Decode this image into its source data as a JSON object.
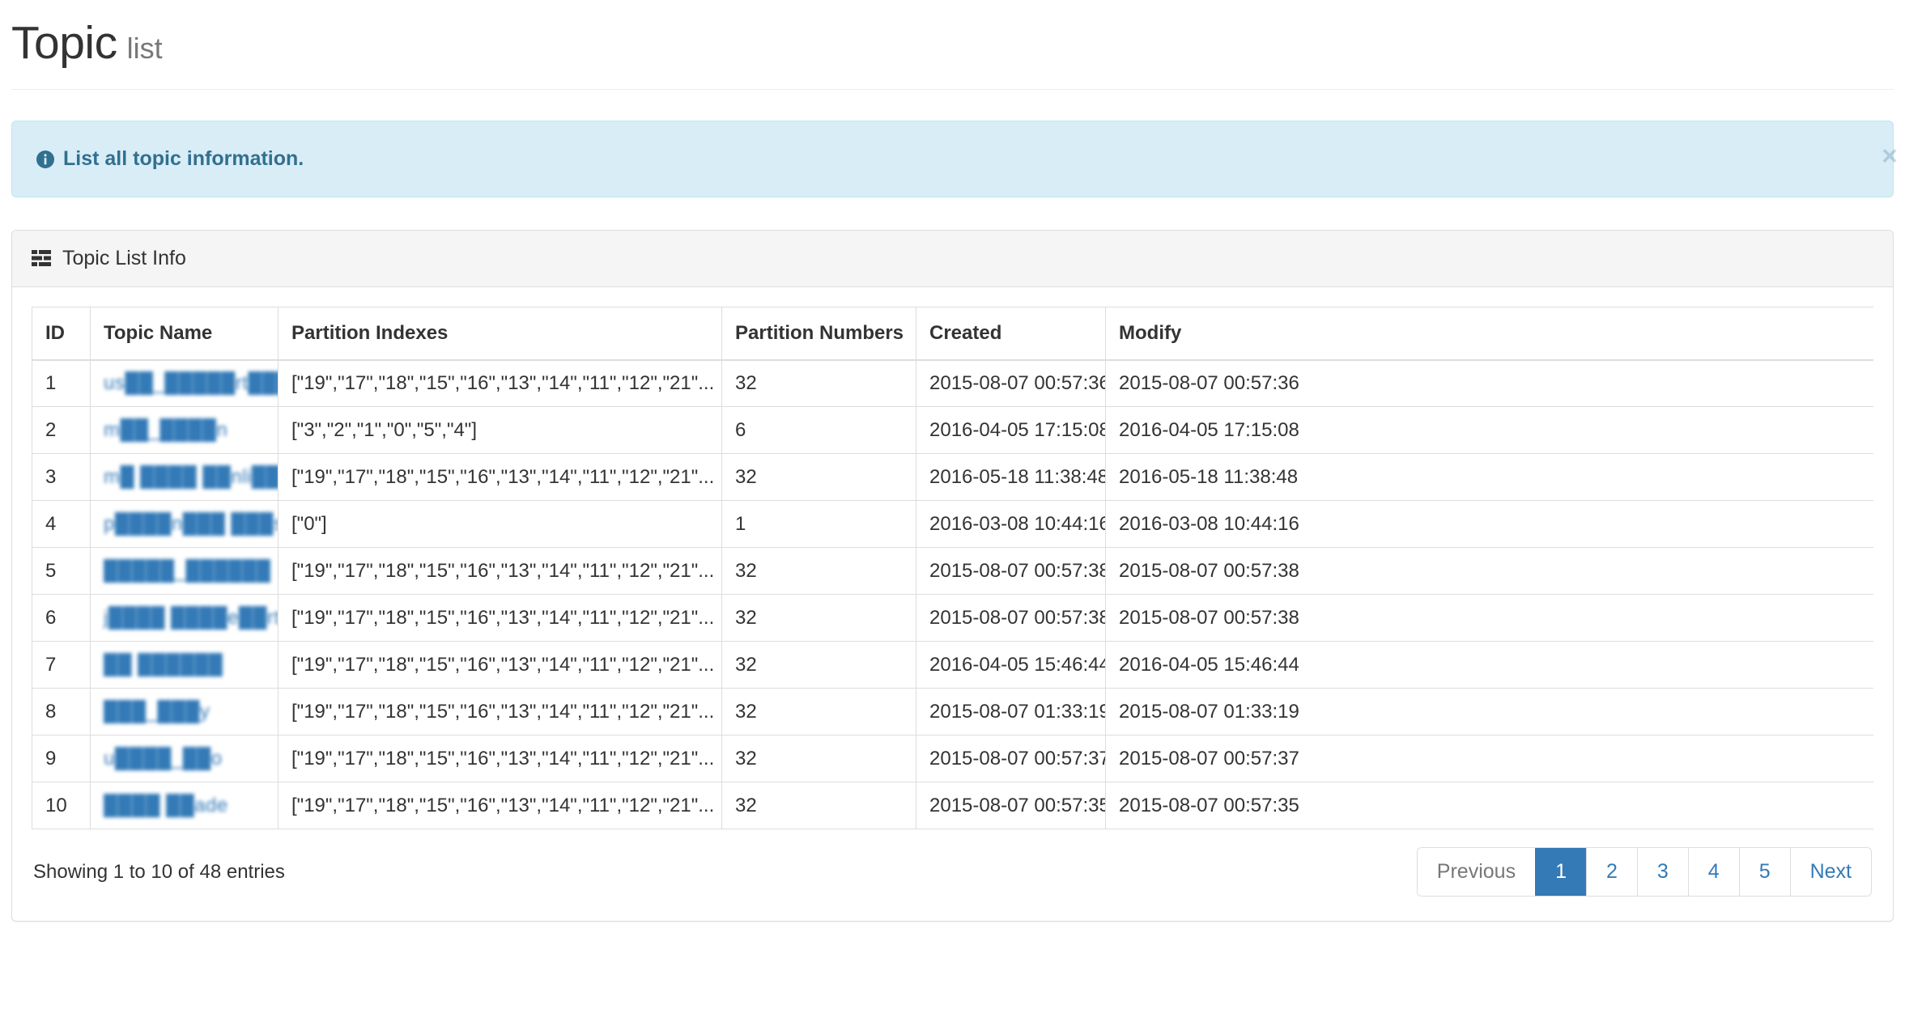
{
  "header": {
    "title": "Topic",
    "subtitle": "list"
  },
  "alert": {
    "icon": "info-circle-icon",
    "text": "List all topic information.",
    "close_label": "×"
  },
  "panel": {
    "icon": "th-list-icon",
    "title": "Topic List Info"
  },
  "table": {
    "columns": [
      "ID",
      "Topic Name",
      "Partition Indexes",
      "Partition Numbers",
      "Created",
      "Modify"
    ],
    "rows": [
      {
        "id": "1",
        "topic_name": "us██_█████rt███_█rder",
        "partition_indexes": "[\"19\",\"17\",\"18\",\"15\",\"16\",\"13\",\"14\",\"11\",\"12\",\"21\"...",
        "partition_numbers": "32",
        "created": "2015-08-07 00:57:36",
        "modify": "2015-08-07 00:57:36"
      },
      {
        "id": "2",
        "topic_name": "m██_████n",
        "partition_indexes": "[\"3\",\"2\",\"1\",\"0\",\"5\",\"4\"]",
        "partition_numbers": "6",
        "created": "2016-04-05 17:15:08",
        "modify": "2016-04-05 17:15:08"
      },
      {
        "id": "3",
        "topic_name": "m█ ████ ██nli██",
        "partition_indexes": "[\"19\",\"17\",\"18\",\"15\",\"16\",\"13\",\"14\",\"11\",\"12\",\"21\"...",
        "partition_numbers": "32",
        "created": "2016-05-18 11:38:48",
        "modify": "2016-05-18 11:38:48"
      },
      {
        "id": "4",
        "topic_name": "p████n███ ███s_dl",
        "partition_indexes": "[\"0\"]",
        "partition_numbers": "1",
        "created": "2016-03-08 10:44:16",
        "modify": "2016-03-08 10:44:16"
      },
      {
        "id": "5",
        "topic_name": "█████_██████",
        "partition_indexes": "[\"19\",\"17\",\"18\",\"15\",\"16\",\"13\",\"14\",\"11\",\"12\",\"21\"...",
        "partition_numbers": "32",
        "created": "2015-08-07 00:57:38",
        "modify": "2015-08-07 00:57:38"
      },
      {
        "id": "6",
        "topic_name": "j████ ████e██rty",
        "partition_indexes": "[\"19\",\"17\",\"18\",\"15\",\"16\",\"13\",\"14\",\"11\",\"12\",\"21\"...",
        "partition_numbers": "32",
        "created": "2015-08-07 00:57:38",
        "modify": "2015-08-07 00:57:38"
      },
      {
        "id": "7",
        "topic_name": "██ ██████",
        "partition_indexes": "[\"19\",\"17\",\"18\",\"15\",\"16\",\"13\",\"14\",\"11\",\"12\",\"21\"...",
        "partition_numbers": "32",
        "created": "2016-04-05 15:46:44",
        "modify": "2016-04-05 15:46:44"
      },
      {
        "id": "8",
        "topic_name": "███_███y",
        "partition_indexes": "[\"19\",\"17\",\"18\",\"15\",\"16\",\"13\",\"14\",\"11\",\"12\",\"21\"...",
        "partition_numbers": "32",
        "created": "2015-08-07 01:33:19",
        "modify": "2015-08-07 01:33:19"
      },
      {
        "id": "9",
        "topic_name": "u████_██o",
        "partition_indexes": "[\"19\",\"17\",\"18\",\"15\",\"16\",\"13\",\"14\",\"11\",\"12\",\"21\"...",
        "partition_numbers": "32",
        "created": "2015-08-07 00:57:37",
        "modify": "2015-08-07 00:57:37"
      },
      {
        "id": "10",
        "topic_name": "████ ██ade",
        "partition_indexes": "[\"19\",\"17\",\"18\",\"15\",\"16\",\"13\",\"14\",\"11\",\"12\",\"21\"...",
        "partition_numbers": "32",
        "created": "2015-08-07 00:57:35",
        "modify": "2015-08-07 00:57:35"
      }
    ]
  },
  "footer": {
    "info": "Showing 1 to 10 of 48 entries",
    "pagination": {
      "previous_label": "Previous",
      "next_label": "Next",
      "pages": [
        "1",
        "2",
        "3",
        "4",
        "5"
      ],
      "active_page": "1",
      "active_color": "#337ab7"
    }
  }
}
